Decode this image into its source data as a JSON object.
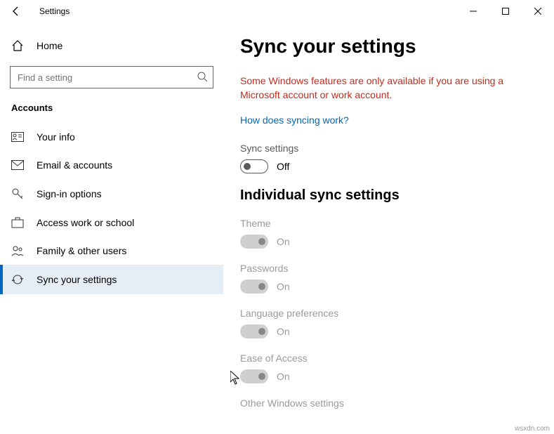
{
  "window": {
    "title": "Settings"
  },
  "sidebar": {
    "home": "Home",
    "search_placeholder": "Find a setting",
    "section": "Accounts",
    "items": [
      {
        "label": "Your info"
      },
      {
        "label": "Email & accounts"
      },
      {
        "label": "Sign-in options"
      },
      {
        "label": "Access work or school"
      },
      {
        "label": "Family & other users"
      },
      {
        "label": "Sync your settings"
      }
    ]
  },
  "main": {
    "heading": "Sync your settings",
    "warning": "Some Windows features are only available if you are using a Microsoft account or work account.",
    "link": "How does syncing work?",
    "sync_label": "Sync settings",
    "sync_state": "Off",
    "subheading": "Individual sync settings",
    "items": [
      {
        "label": "Theme",
        "state": "On"
      },
      {
        "label": "Passwords",
        "state": "On"
      },
      {
        "label": "Language preferences",
        "state": "On"
      },
      {
        "label": "Ease of Access",
        "state": "On"
      },
      {
        "label": "Other Windows settings",
        "state": ""
      }
    ]
  },
  "watermark": "wsxdn.com"
}
